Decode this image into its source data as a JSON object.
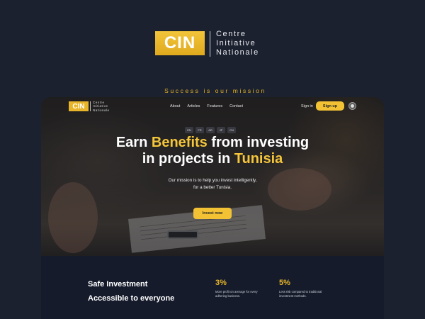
{
  "brand": {
    "logo_text": "CIN",
    "name_lines": [
      "Centre",
      "Initiative",
      "Nationale"
    ],
    "tagline": "Success is our mission",
    "accent_color": "#e8b52a"
  },
  "nav": {
    "logo_text": "CIN",
    "brand_lines": [
      "Centre",
      "Initiative",
      "Nationale"
    ],
    "links": [
      "About",
      "Articles",
      "Features",
      "Contact"
    ],
    "signin_label": "Sign in",
    "signup_label": "Sign up",
    "theme_toggle_icon": "theme-toggle-icon"
  },
  "hero": {
    "languages": [
      "EN",
      "FR",
      "AR",
      "JP",
      "CN"
    ],
    "title": {
      "part1": "Earn ",
      "highlight1": "Benefits",
      "part2": " from investing",
      "part3": "in projects in ",
      "highlight2": "Tunisia"
    },
    "subtitle_lines": [
      "Our mission is to help you invest intelligently,",
      "for a better Tunisia."
    ],
    "cta_label": "Invest now"
  },
  "stats": {
    "heading_lines": [
      "Safe Investment",
      "Accessible to everyone"
    ],
    "items": [
      {
        "value": "3%",
        "desc_lines": [
          "More profit on average for every",
          "adhering business."
        ]
      },
      {
        "value": "5%",
        "desc_lines": [
          "Less risk compared to traditional",
          "investment methods."
        ]
      }
    ]
  }
}
